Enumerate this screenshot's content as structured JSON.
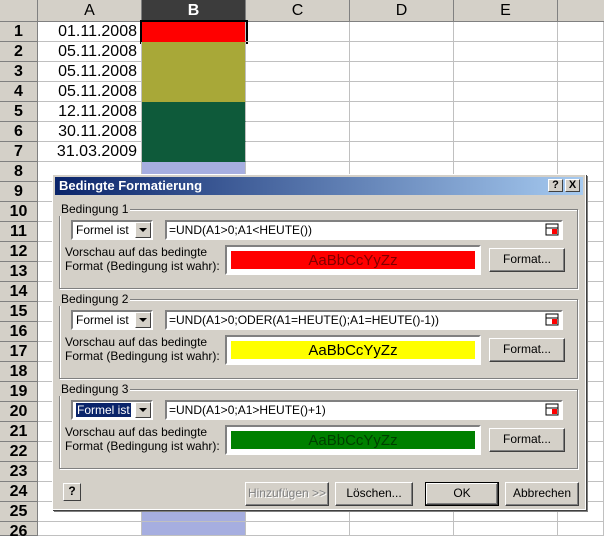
{
  "sheet": {
    "columns": [
      "A",
      "B",
      "C",
      "D",
      "E"
    ],
    "rows": [
      "1",
      "2",
      "3",
      "4",
      "5",
      "6",
      "7",
      "8",
      "9",
      "10",
      "11",
      "12",
      "13",
      "14",
      "15",
      "16",
      "17",
      "18",
      "19",
      "20",
      "21",
      "22",
      "23",
      "24",
      "25",
      "26"
    ],
    "dates": [
      "01.11.2008",
      "05.11.2008",
      "05.11.2008",
      "05.11.2008",
      "12.11.2008",
      "30.11.2008",
      "31.03.2009"
    ],
    "fill_colors": {
      "red": "#ff0000",
      "yellow": "#a8a838",
      "green": "#0e5a3a",
      "selection": "#a6aee0"
    }
  },
  "dialog": {
    "title": "Bedingte Formatierung",
    "help_btn": "?",
    "close_btn": "X",
    "preview_label_1": "Vorschau auf das bedingte",
    "preview_label_2": "Format (Bedingung ist wahr):",
    "sample_text": "AaBbCcYyZz",
    "conditions": [
      {
        "label": "Bedingung 1",
        "type": "Formel ist",
        "formula": "=UND(A1>0;A1<HEUTE())",
        "color": "#ff0000",
        "text_color": "#800000",
        "format_btn": "Format..."
      },
      {
        "label": "Bedingung 2",
        "type": "Formel ist",
        "formula": "=UND(A1>0;ODER(A1=HEUTE();A1=HEUTE()-1))",
        "color": "#ffff00",
        "text_color": "#000000",
        "format_btn": "Format..."
      },
      {
        "label": "Bedingung 3",
        "type": "Formel ist",
        "formula": "=UND(A1>0;A1>HEUTE()+1)",
        "color": "#008000",
        "text_color": "#004000",
        "format_btn": "Format..."
      }
    ],
    "buttons": {
      "add": "Hinzufügen >>",
      "delete": "Löschen...",
      "ok": "OK",
      "cancel": "Abbrechen"
    }
  }
}
